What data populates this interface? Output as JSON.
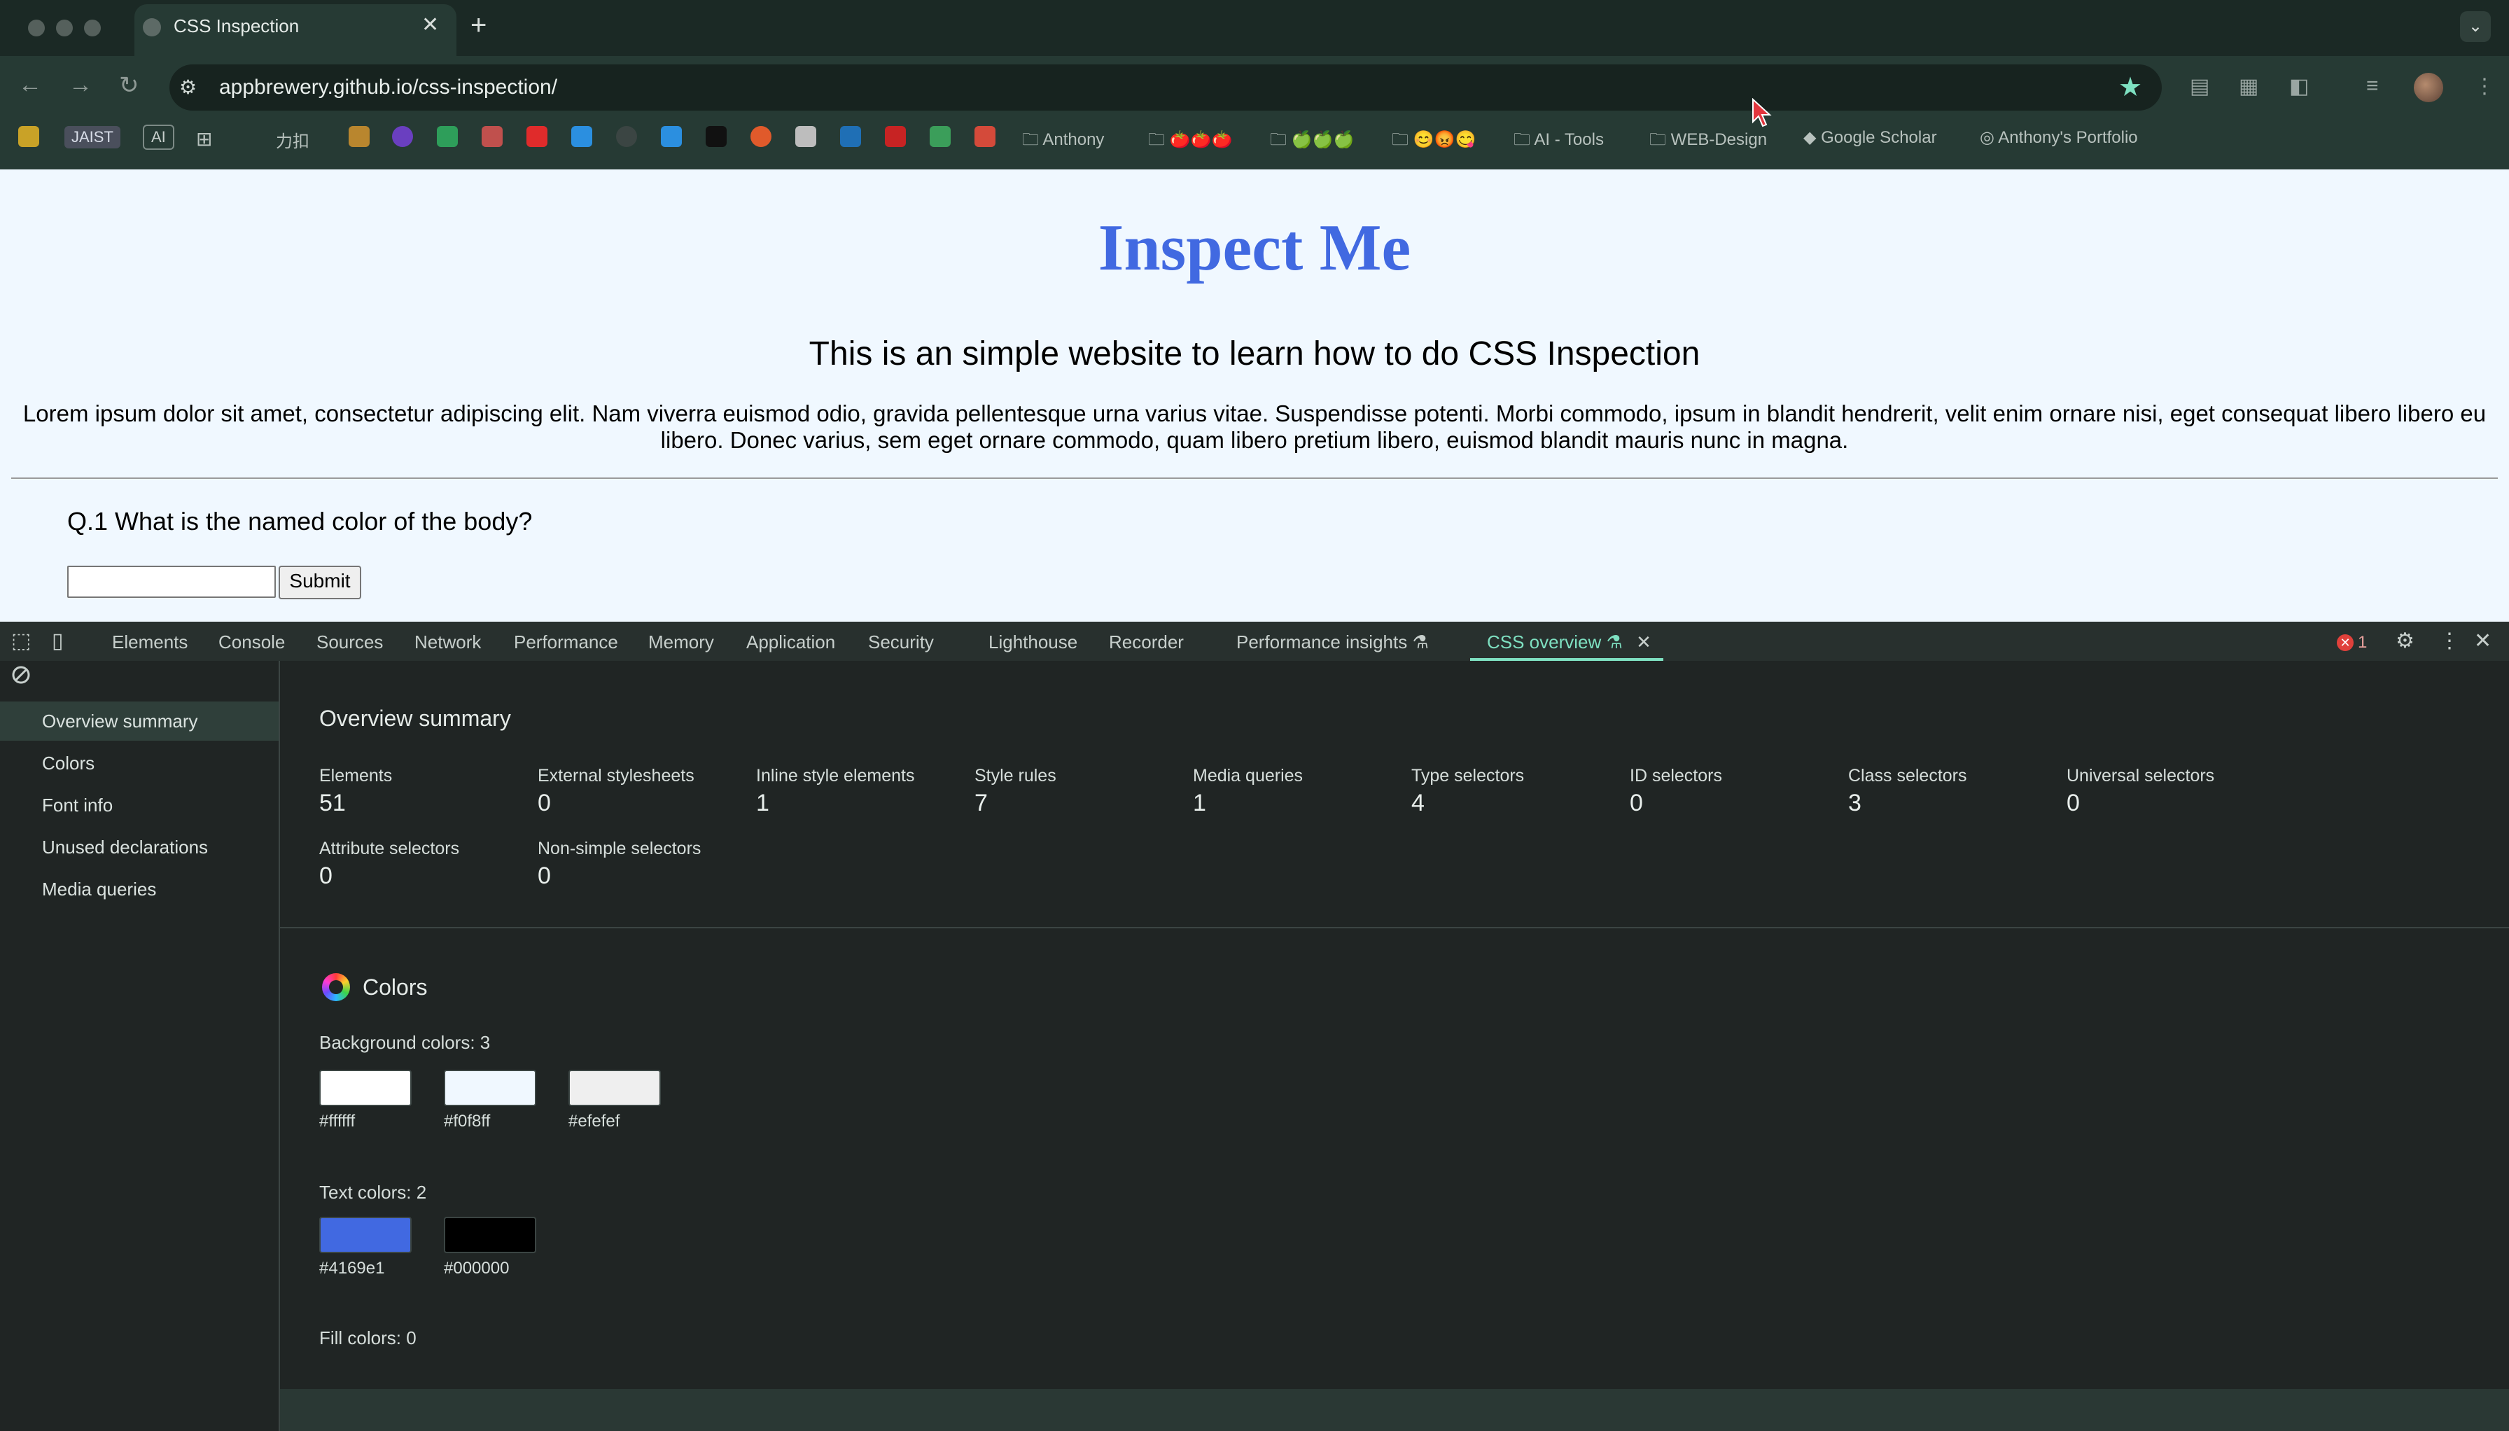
{
  "browser": {
    "tab_title": "CSS Inspection",
    "new_tab": "+",
    "tab_close": "✕",
    "url": "appbrewery.github.io/css-inspection/"
  },
  "bookmarks": {
    "jaist": "JAIST",
    "ai_badge": "AI",
    "chinese": "力扣",
    "folders": [
      "Anthony",
      "🍅🍅🍅",
      "🍏🍏🍏",
      "😊😡😋",
      "AI - Tools",
      "WEB-Design"
    ],
    "google_scholar": "Google Scholar",
    "portfolio": "Anthony's Portfolio"
  },
  "page": {
    "heading": "Inspect Me",
    "subheading": "This is an simple website to learn how to do CSS Inspection",
    "paragraph": "Lorem ipsum dolor sit amet, consectetur adipiscing elit. Nam viverra euismod odio, gravida pellentesque urna varius vitae. Suspendisse potenti. Morbi commodo, ipsum in blandit hendrerit, velit enim ornare nisi, eget consequat libero libero eu libero. Donec varius, sem eget ornare commodo, quam libero pretium libero, euismod blandit mauris nunc in magna.",
    "question": "Q.1 What is the named color of the body?",
    "answer_value": "",
    "submit_label": "Submit"
  },
  "devtools": {
    "tabs": [
      "Elements",
      "Console",
      "Sources",
      "Network",
      "Performance",
      "Memory",
      "Application",
      "Security",
      "Lighthouse",
      "Recorder",
      "Performance insights",
      "CSS overview"
    ],
    "error_count": "1",
    "sidebar": [
      "Overview summary",
      "Colors",
      "Font info",
      "Unused declarations",
      "Media queries"
    ],
    "overview": {
      "title": "Overview summary",
      "stats": [
        {
          "label": "Elements",
          "value": "51"
        },
        {
          "label": "External stylesheets",
          "value": "0"
        },
        {
          "label": "Inline style elements",
          "value": "1"
        },
        {
          "label": "Style rules",
          "value": "7"
        },
        {
          "label": "Media queries",
          "value": "1"
        },
        {
          "label": "Type selectors",
          "value": "4"
        },
        {
          "label": "ID selectors",
          "value": "0"
        },
        {
          "label": "Class selectors",
          "value": "3"
        },
        {
          "label": "Universal selectors",
          "value": "0"
        },
        {
          "label": "Attribute selectors",
          "value": "0"
        },
        {
          "label": "Non-simple selectors",
          "value": "0"
        }
      ]
    },
    "colors": {
      "title": "Colors",
      "background_label": "Background colors: 3",
      "background": [
        "#ffffff",
        "#f0f8ff",
        "#efefef"
      ],
      "text_label": "Text colors: 2",
      "text": [
        "#4169e1",
        "#000000"
      ],
      "fill_label": "Fill colors: 0"
    }
  }
}
